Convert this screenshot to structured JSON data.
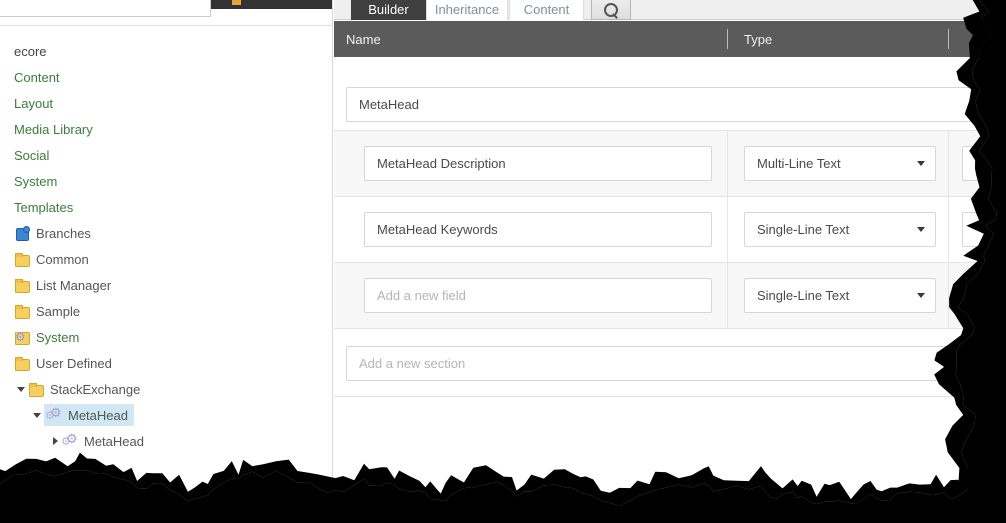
{
  "left_panel": {
    "search": {
      "value": "",
      "placeholder": ""
    },
    "orange_marker_icon": "orange-marker-icon",
    "tree": [
      {
        "label": "ecore",
        "icon": "none",
        "color": "dark",
        "indent": 0,
        "toggle": "none",
        "selected": false
      },
      {
        "label": "Content",
        "icon": "none",
        "color": "green",
        "indent": 0,
        "toggle": "none",
        "selected": false
      },
      {
        "label": "Layout",
        "icon": "none",
        "color": "green",
        "indent": 0,
        "toggle": "none",
        "selected": false
      },
      {
        "label": "Media Library",
        "icon": "none",
        "color": "green",
        "indent": 0,
        "toggle": "none",
        "selected": false
      },
      {
        "label": "Social",
        "icon": "none",
        "color": "green",
        "indent": 0,
        "toggle": "none",
        "selected": false
      },
      {
        "label": "System",
        "icon": "none",
        "color": "green",
        "indent": 0,
        "toggle": "none",
        "selected": false
      },
      {
        "label": "Templates",
        "icon": "none",
        "color": "green",
        "indent": 0,
        "toggle": "none",
        "selected": false
      },
      {
        "label": "Branches",
        "icon": "puzzle-icon",
        "color": "gray",
        "indent": 0,
        "toggle": "none",
        "selected": false
      },
      {
        "label": "Common",
        "icon": "folder-icon",
        "color": "gray",
        "indent": 0,
        "toggle": "none",
        "selected": false
      },
      {
        "label": "List Manager",
        "icon": "folder-icon",
        "color": "gray",
        "indent": 0,
        "toggle": "none",
        "selected": false
      },
      {
        "label": "Sample",
        "icon": "folder-icon",
        "color": "gray",
        "indent": 0,
        "toggle": "none",
        "selected": false
      },
      {
        "label": "System",
        "icon": "folder-gear-icon",
        "color": "green",
        "indent": 0,
        "toggle": "none",
        "selected": false
      },
      {
        "label": "User Defined",
        "icon": "folder-icon",
        "color": "gray",
        "indent": 0,
        "toggle": "none",
        "selected": false
      },
      {
        "label": "StackExchange",
        "icon": "folder-icon",
        "color": "gray",
        "indent": 14,
        "toggle": "down",
        "selected": false
      },
      {
        "label": "MetaHead",
        "icon": "gears-icon",
        "color": "gray",
        "indent": 30,
        "toggle": "down",
        "selected": true
      },
      {
        "label": "MetaHead",
        "icon": "gears-icon",
        "color": "gray",
        "indent": 48,
        "toggle": "right",
        "selected": false
      }
    ]
  },
  "main": {
    "tabs": [
      {
        "label": "Builder",
        "active": true
      },
      {
        "label": "Inheritance",
        "active": false
      },
      {
        "label": "Content",
        "active": false
      }
    ],
    "search_button_icon": "search-icon",
    "columns": {
      "name": "Name",
      "type": "Type"
    },
    "section": {
      "name": "MetaHead",
      "add_section_placeholder": "Add a new section"
    },
    "fields": [
      {
        "name": "MetaHead Description",
        "name_is_placeholder": false,
        "type": "Multi-Line Text",
        "stripe": "odd"
      },
      {
        "name": "MetaHead Keywords",
        "name_is_placeholder": false,
        "type": "Single-Line Text",
        "stripe": "even"
      },
      {
        "name": "Add a new field",
        "name_is_placeholder": true,
        "type": "Single-Line Text",
        "stripe": "odd"
      }
    ]
  },
  "colors": {
    "tab_active_bg": "#3f3f3f",
    "header_bg": "#5b5b5b",
    "tree_link_green": "#3b7d3b",
    "selection_bg": "#cfe8f3",
    "accent_orange": "#e8a33d"
  }
}
